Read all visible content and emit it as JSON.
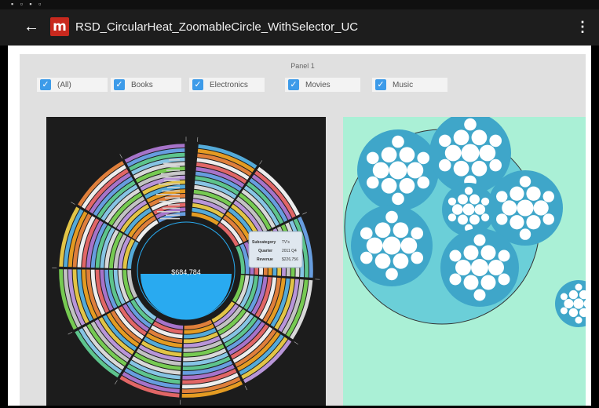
{
  "app": {
    "title": "RSD_CircularHeat_ZoomableCircle_WithSelector_UC",
    "back_icon": "arrow-left-icon",
    "menu_icon": "more-vert-icon",
    "logo_letter": "m",
    "brand_color": "#c8291e"
  },
  "panel": {
    "title": "Panel 1",
    "filters": [
      {
        "label": "(All)",
        "checked": true
      },
      {
        "label": "Books",
        "checked": true
      },
      {
        "label": "Electronics",
        "checked": true
      },
      {
        "label": "Movies",
        "checked": true
      },
      {
        "label": "Music",
        "checked": true
      }
    ]
  },
  "circular_heat": {
    "center_value": "$684,784",
    "tooltip": {
      "rows": [
        {
          "label": "Subcategory",
          "value": "TV's"
        },
        {
          "label": "Quarter",
          "value": "2011 Q4"
        },
        {
          "label": "Revenue",
          "value": "$226,756"
        }
      ]
    },
    "accent_color": "#29aaf0"
  },
  "zoomable_circle": {
    "background_color": "#aaf0d6",
    "outer_color": "#6bcfd8",
    "cluster_color": "#3fa6c9"
  }
}
